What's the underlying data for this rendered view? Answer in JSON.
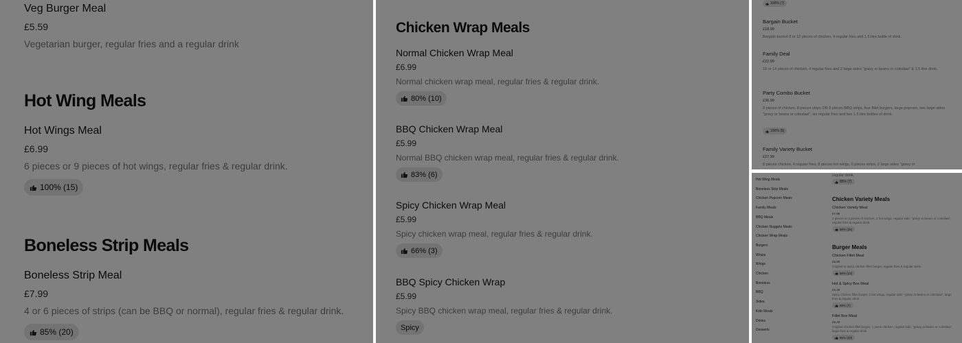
{
  "panel1": {
    "veg_burger": {
      "name": "Veg Burger Meal",
      "price": "£5.59",
      "desc": "Vegetarian burger, regular fries and a regular drink"
    },
    "hot_wing_title": "Hot Wing Meals",
    "hot_wings": {
      "name": "Hot Wings Meal",
      "price": "£6.99",
      "desc": "6 pieces or 9 pieces of hot wings, regular fries & regular drink.",
      "rating": "100% (15)"
    },
    "boneless_title": "Boneless Strip Meals",
    "boneless": {
      "name": "Boneless Strip Meal",
      "price": "£7.99",
      "desc": "4 or 6 pieces of strips (can be BBQ or normal), regular fries & regular drink.",
      "rating": "85% (20)"
    }
  },
  "panel2": {
    "title": "Chicken Wrap Meals",
    "items": [
      {
        "name": "Normal Chicken Wrap Meal",
        "price": "£6.99",
        "desc": "Normal chicken wrap meal, regular fries & regular drink.",
        "rating": "80% (10)"
      },
      {
        "name": "BBQ Chicken Wrap Meal",
        "price": "£5.99",
        "desc": "Normal BBQ chicken wrap meal, regular fries & regular drink.",
        "rating": "83% (6)"
      },
      {
        "name": "Spicy Chicken Wrap Meal",
        "price": "£5.99",
        "desc": "Spicy chicken wrap meal, regular fries & regular drink.",
        "rating": "66% (3)"
      },
      {
        "name": "BBQ Spicy Chicken Wrap",
        "price": "£5.99",
        "desc": "Spicy BBQ chicken wrap meal, regular fries & regular drink.",
        "tag": "Spicy"
      }
    ]
  },
  "panel3": {
    "top_rating": "100% (7)",
    "items": [
      {
        "name": "Bargain Bucket",
        "price": "£18.99",
        "desc": "Bargain bucket 8 or 12 pieces of chicken, 4 regular fries and 1.5 litre bottle of drink."
      },
      {
        "name": "Family Deal",
        "price": "£22.99",
        "desc": "10 or 14 pieces of chicken, 4 regular fries and 2 large sides \"gravy or beans or coleslaw\" & 1.5 litre drink."
      },
      {
        "name": "Party Combo Bucket",
        "price": "£36.99",
        "desc": "8 pieces of chicken, 8 pieces strips OR 8 pieces BBQ strips, four fillet burgers, large popcorn, two large sides \"gravy or beans or coleslaw\", six regular fries and two 1.5 litre bottles of drink.",
        "rating": "100% (8)"
      },
      {
        "name": "Family Variety Bucket",
        "price": "£27.99",
        "desc": "8 pieces chicken, 4 regular fries, 8 pieces hot wings, 6 pieces strips, 2 large sides \"gravy or"
      }
    ]
  },
  "panel4": {
    "nav": [
      "Hot Wing Meals",
      "Boneless Strip Meals",
      "Chicken Popcorn Meals",
      "Family Meals",
      "BBQ Meals",
      "Chicken Nuggets Meals",
      "Chicken Wrap Meals",
      "Burgers",
      "Wraps",
      "Wings",
      "Chicken",
      "Boneless",
      "BBQ",
      "Sides",
      "Kids Meals",
      "Drinks",
      "Desserts"
    ],
    "top_desc": "regular drink.",
    "top_rating": "85% (7)",
    "variety_title": "Chicken Variety Meals",
    "variety": {
      "name": "Chicken Variety Meal",
      "price": "£7.99",
      "desc": "2 pieces or 3 pieces of chicken, 2 hot wings, regular side, \"gravy or beans or coleslaw\", regular fries & regular drink.",
      "rating": "88% (25)"
    },
    "burger_title": "Burger Meals",
    "burgers": [
      {
        "name": "Chicken Fillet Meal",
        "price": "£5.99",
        "desc": "Original or spicy chicken fillet burger, regular fries & regular drink.",
        "rating": "86% (23)"
      },
      {
        "name": "Hot & Spicy Box Meal",
        "price": "£5.49",
        "desc": "Spicy chicken fillet burger, 2 hot wings, regular side, \"gravy or beans or coleslaw\", large fries & regular drink.",
        "rating": "88% (7)"
      },
      {
        "name": "Fillet Box Meal",
        "price": "£5.49",
        "desc": "Original chicken fillet burger, 1 piece chicken, regular side, \"gravy or beans or coleslaw\", large fries & regular drink.",
        "rating": "80% (20)"
      }
    ]
  },
  "icons": {
    "rating": "thumbs-up-icon"
  },
  "colors": {
    "overlay": "#808080",
    "badge": "#737373",
    "separator": "#ffffff"
  }
}
